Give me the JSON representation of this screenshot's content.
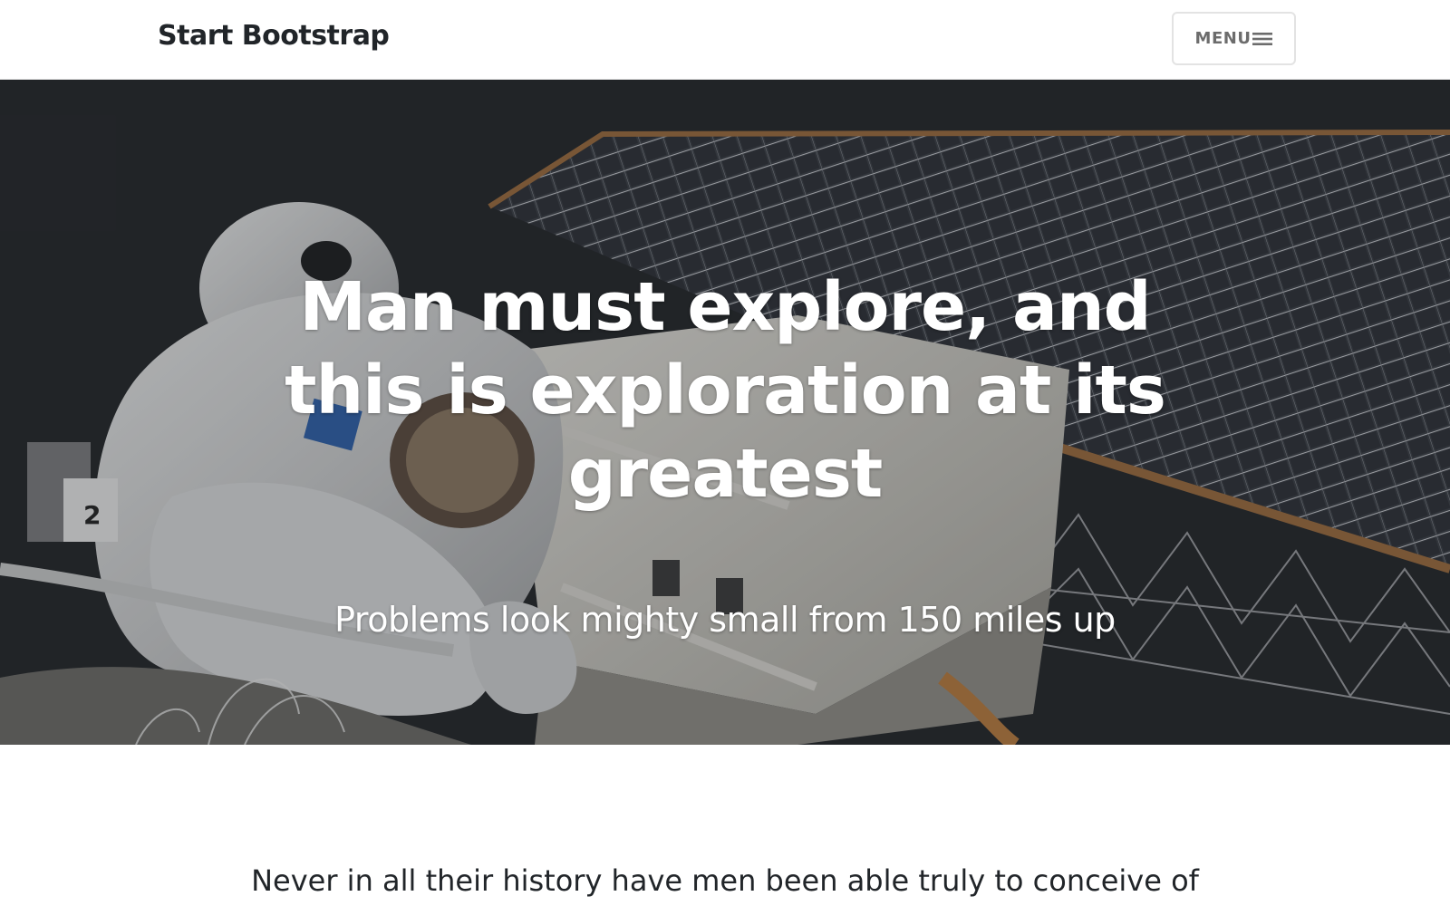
{
  "navbar": {
    "brand": "Start Bootstrap",
    "menu_label": "MENU",
    "menu_icon": "bars-icon"
  },
  "hero": {
    "title": "Man must explore, and this is exploration at its greatest",
    "subtitle": "Problems look mighty small from 150 miles up",
    "background_image": "astronaut-spacewalk-solar-panel"
  },
  "content": {
    "first_line": "Never in all their history have men been able truly to conceive of"
  },
  "colors": {
    "text_dark": "#212529",
    "menu_text": "#6c6c6c",
    "hero_dark": "#24272b",
    "white": "#ffffff"
  }
}
